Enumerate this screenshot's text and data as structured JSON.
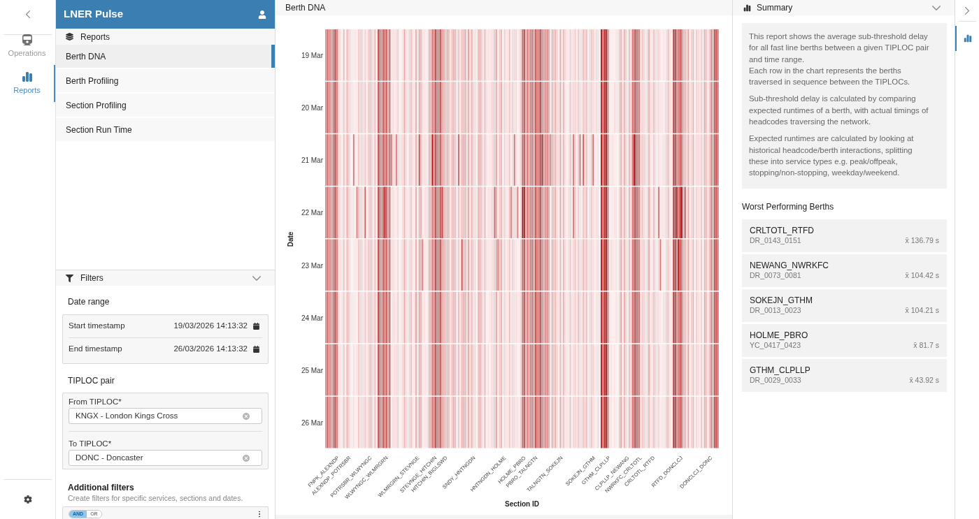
{
  "nav_rail": {
    "items": [
      {
        "label": "Operations",
        "kind": "train",
        "selected": false
      },
      {
        "label": "Reports",
        "kind": "chart",
        "selected": true
      }
    ]
  },
  "sidebar": {
    "title": "LNER Pulse",
    "reports": {
      "heading": "Reports",
      "items": [
        {
          "label": "Berth DNA",
          "selected": true
        },
        {
          "label": "Berth Profiling",
          "selected": false
        },
        {
          "label": "Section Profiling",
          "selected": false
        },
        {
          "label": "Section Run Time",
          "selected": false
        }
      ]
    },
    "filters": {
      "heading": "Filters",
      "expanded": true,
      "date_range": {
        "label": "Date range",
        "fields": [
          {
            "label": "Start timestamp",
            "value": "19/03/2026 14:13:32"
          },
          {
            "label": "End timestamp",
            "value": "26/03/2026 14:13:32"
          }
        ]
      },
      "tiploc_pair": {
        "label": "TIPLOC pair",
        "fields": [
          {
            "label": "From TIPLOC*",
            "value": "KNGX - London Kings Cross"
          },
          {
            "label": "To TIPLOC*",
            "value": "DONC - Doncaster"
          }
        ]
      },
      "additional_filters": {
        "label": "Additional filters",
        "hint": "Create filters for specific services, sections and dates.",
        "logic": [
          {
            "label": "AND",
            "selected": true
          },
          {
            "label": "OR",
            "selected": false
          }
        ]
      }
    }
  },
  "main": {
    "title": "Berth DNA",
    "chart": {
      "ylabel": "Date",
      "xlabel": "Section ID",
      "row_labels": [
        "19 Mar",
        "20 Mar",
        "21 Mar",
        "22 Mar",
        "23 Mar",
        "24 Mar",
        "25 Mar",
        "26 Mar"
      ],
      "column_labels": [
        "FNPK_ALEXNDP",
        "ALEXNDP_POTRSBR",
        "POTRSBR_WLWYNGC",
        "WLWYNGC_WLMRGRN",
        "WLMRGRN_STEVNGE",
        "STEVNGE_HITCHIN",
        "HITCHIN_BIGLSWD",
        "SNDY_HNTNGDN",
        "HNTNGDN_HOLME",
        "HOLME_PBRO",
        "PBRO_TALNGTN",
        "TALNGTN_SOKEJN",
        "SOKEJN_GTHM",
        "GTHM_CLPLLP",
        "CLPLLP_NEWANG",
        "NWRKFC_CRLTOTL",
        "CRLTOTL_RTFD",
        "RTFD_DONCLCJ",
        "DONCLCJ_DONC"
      ]
    }
  },
  "summary": {
    "heading": "Summary",
    "expanded": true,
    "paragraphs": [
      [
        "This report shows the average sub-threshold delay for all fast line berths between a given TIPLOC pair and time range.",
        "Each row in the chart represents the berths traversed in sequence between the TIPLOCs."
      ],
      [
        "Sub-threshold delay is calculated by comparing expected runtimes of a berth, with actual timings of headcodes traversing the network."
      ],
      [
        "Expected runtimes are calculated by looking at historical headcode/berth interactions, splitting these into service types e.g. peak/offpeak, stopping/non-stopping, weekday/weekend."
      ]
    ],
    "berths_heading": "Worst Performing Berths",
    "berths": [
      {
        "name": "CRLTOTL_RTFD",
        "code": "DR_0143_0151",
        "value": "x̄ 136.79 s"
      },
      {
        "name": "NEWANG_NWRKFC",
        "code": "DR_0073_0081",
        "value": "x̄ 104.42 s"
      },
      {
        "name": "SOKEJN_GTHM",
        "code": "DR_0013_0023",
        "value": "x̄ 104.21 s"
      },
      {
        "name": "HOLME_PBRO",
        "code": "YC_0417_0423",
        "value": "x̄ 81.7 s"
      },
      {
        "name": "GTHM_CLPLLP",
        "code": "DR_0029_0033",
        "value": "x̄ 43.92 s"
      }
    ]
  },
  "right_rail": {
    "items": [
      {
        "kind": "chart",
        "selected": true
      }
    ]
  }
}
